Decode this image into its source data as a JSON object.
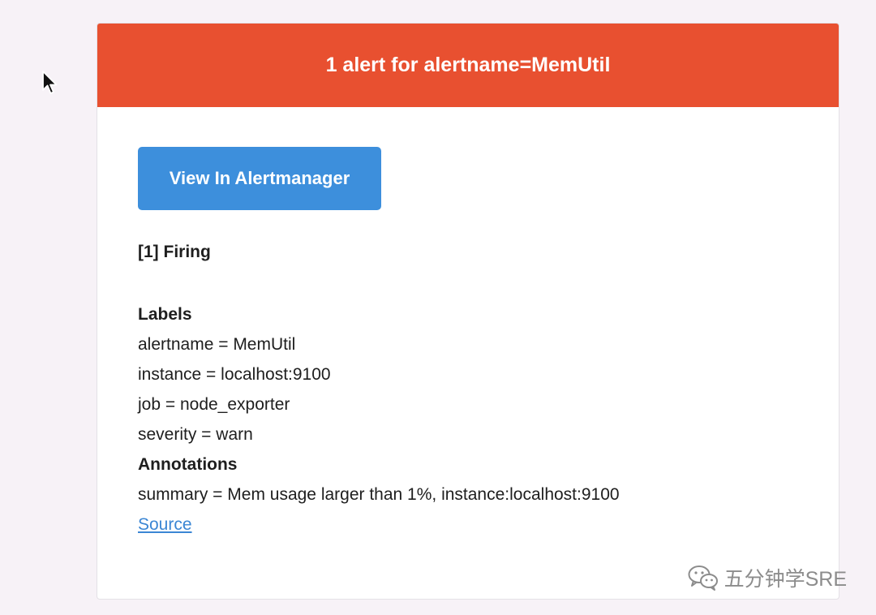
{
  "header": {
    "title": "1 alert for alertname=MemUtil"
  },
  "actions": {
    "view_button_label": "View In Alertmanager"
  },
  "alert": {
    "firing_title": "[1] Firing",
    "labels_title": "Labels",
    "labels": [
      "alertname = MemUtil",
      "instance = localhost:9100",
      "job = node_exporter",
      "severity = warn"
    ],
    "annotations_title": "Annotations",
    "annotations": [
      "summary = Mem usage larger than 1%, instance:localhost:9100"
    ],
    "source_link": "Source"
  },
  "watermark": {
    "text": "五分钟学SRE",
    "icon": "wechat-icon"
  },
  "colors": {
    "header_bg": "#e85030",
    "button_bg": "#3d8fdc",
    "link": "#3b86d4",
    "page_bg": "#f7f2f7"
  }
}
